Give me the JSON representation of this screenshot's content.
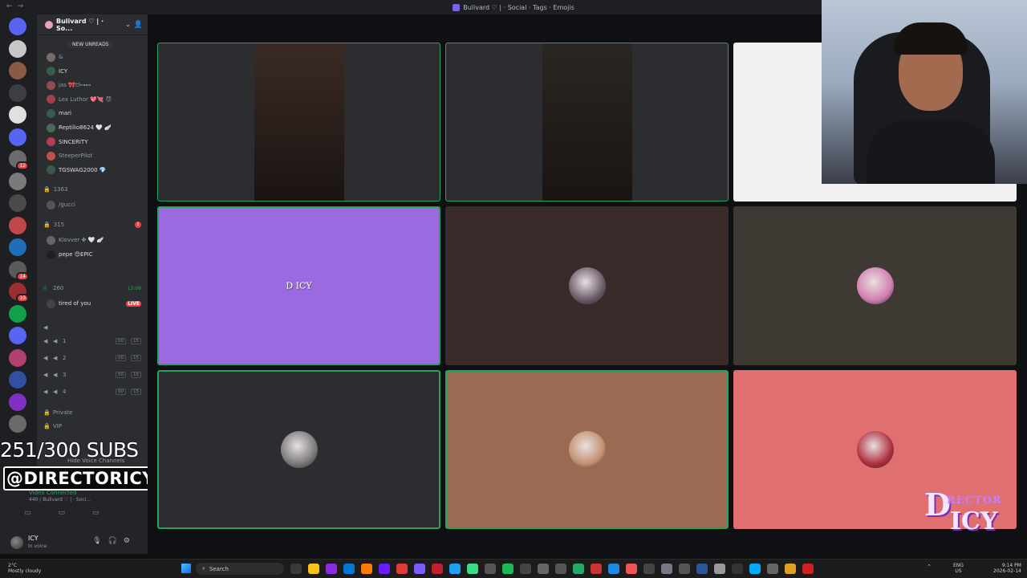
{
  "window": {
    "title": "Bulivard ♡ | · Social · Tags · Emojis"
  },
  "guild": {
    "name": "Bulivard ♡ | · So...",
    "new_unreads": "NEW UNREADS"
  },
  "rail_servers": [
    {
      "color": "#5865f2",
      "badge": ""
    },
    {
      "color": "#c8c8c8",
      "badge": ""
    },
    {
      "color": "#8a5a44",
      "badge": ""
    },
    {
      "color": "#3d3f45",
      "badge": ""
    },
    {
      "color": "#e0e0e0",
      "badge": ""
    },
    {
      "color": "#5865f2",
      "badge": ""
    },
    {
      "color": "#6b6b6b",
      "badge": "12"
    },
    {
      "color": "#7a7a7a",
      "badge": ""
    },
    {
      "color": "#4a4a4a",
      "badge": ""
    },
    {
      "color": "#c04848",
      "badge": ""
    },
    {
      "color": "#1e6fb8",
      "badge": ""
    },
    {
      "color": "#5a5a5a",
      "badge": "14"
    },
    {
      "color": "#9a2f2f",
      "badge": "10"
    },
    {
      "color": "#12a04a",
      "badge": ""
    },
    {
      "color": "#5865f2",
      "badge": ""
    },
    {
      "color": "#b04070",
      "badge": ""
    },
    {
      "color": "#3050a0",
      "badge": ""
    },
    {
      "color": "#8030c0",
      "badge": ""
    },
    {
      "color": "#6a6a6a",
      "badge": ""
    }
  ],
  "voice_members": [
    {
      "name": "&",
      "color": "#7a6a6a"
    },
    {
      "name": "ICY",
      "color": "#3a5a4a"
    },
    {
      "name": "jas 🎀ᗢ⊶⊷",
      "color": "#8a5050"
    },
    {
      "name": "Lex Luthor 💖💘 😈",
      "color": "#a04050"
    },
    {
      "name": "mari",
      "color": "#3a5a4a"
    },
    {
      "name": "Reptilio8624 🤍 🪽",
      "color": "#4a6a5a"
    },
    {
      "name": "SINCERITY",
      "color": "#b04050"
    },
    {
      "name": "SteeperPilot",
      "color": "#c05050"
    },
    {
      "name": "TGSWAG2000 💎",
      "color": "#3a5a4a"
    }
  ],
  "channels": {
    "c1363": "1363",
    "gucci": "/gucci",
    "c315": "315",
    "c315_count": "1",
    "klovver": "Klovver ✤ 🤍 🪽",
    "pepe": "pepe 😊EPIC",
    "c260": "260",
    "c260_time": "13:09",
    "tired": "tired of you",
    "live": "LIVE",
    "voice": [
      {
        "name": "1",
        "a": "00",
        "b": "15"
      },
      {
        "name": "2",
        "a": "00",
        "b": "15"
      },
      {
        "name": "3",
        "a": "00",
        "b": "15"
      },
      {
        "name": "4",
        "a": "00",
        "b": "15"
      }
    ],
    "private": "Private",
    "vip": "VIP"
  },
  "overlay": {
    "subs": "251/300 SUBS",
    "handle": "@DIRECTORICY",
    "watermark_d": "D",
    "watermark_r": "RECTOR",
    "watermark_i": "ICY"
  },
  "voice_panel": {
    "hide": "Hide Voice Channels",
    "status": "Video Connected",
    "location": "440 / Bulivard ♡ | · Soci..."
  },
  "user": {
    "name": "ICY",
    "status": "In voice"
  },
  "tiles": [
    {
      "label": "video-tile-1",
      "kind": "cam",
      "video_color": "#3b2a24",
      "tint": "#2b2d31"
    },
    {
      "label": "video-tile-2",
      "kind": "cam",
      "video_color": "#2a2622",
      "tint": "#2b2d31"
    },
    {
      "label": "video-tile-3",
      "kind": "plain",
      "tint": "#f0f0f0"
    },
    {
      "label": "video-tile-4",
      "kind": "text",
      "tint": "#9b6ae0",
      "text": "D ICY"
    },
    {
      "label": "video-tile-5",
      "kind": "avatar",
      "tint": "#3a2a2a",
      "avatar_color": "#6a5a6a"
    },
    {
      "label": "video-tile-6",
      "kind": "avatar",
      "tint": "#3e3a33",
      "avatar_color": "#d080b0"
    },
    {
      "label": "video-tile-7",
      "kind": "avatar",
      "tint": "#2b2d31",
      "avatar_color": "#7a7a7a"
    },
    {
      "label": "video-tile-8",
      "kind": "avatar",
      "tint": "#9a6a52",
      "avatar_color": "#c29070"
    },
    {
      "label": "video-tile-9",
      "kind": "avatar",
      "tint": "#e07070",
      "avatar_color": "#b03040"
    }
  ],
  "taskbar": {
    "weather_temp": "2°C",
    "weather_desc": "Mostly cloudy",
    "search": "Search",
    "lang1": "ENG",
    "lang2": "US",
    "time": "9:14 PM",
    "date": "2026-02-14"
  },
  "colors": {
    "accent_green": "#23a55a",
    "danger": "#f23f43",
    "brand": "#5865f2"
  }
}
